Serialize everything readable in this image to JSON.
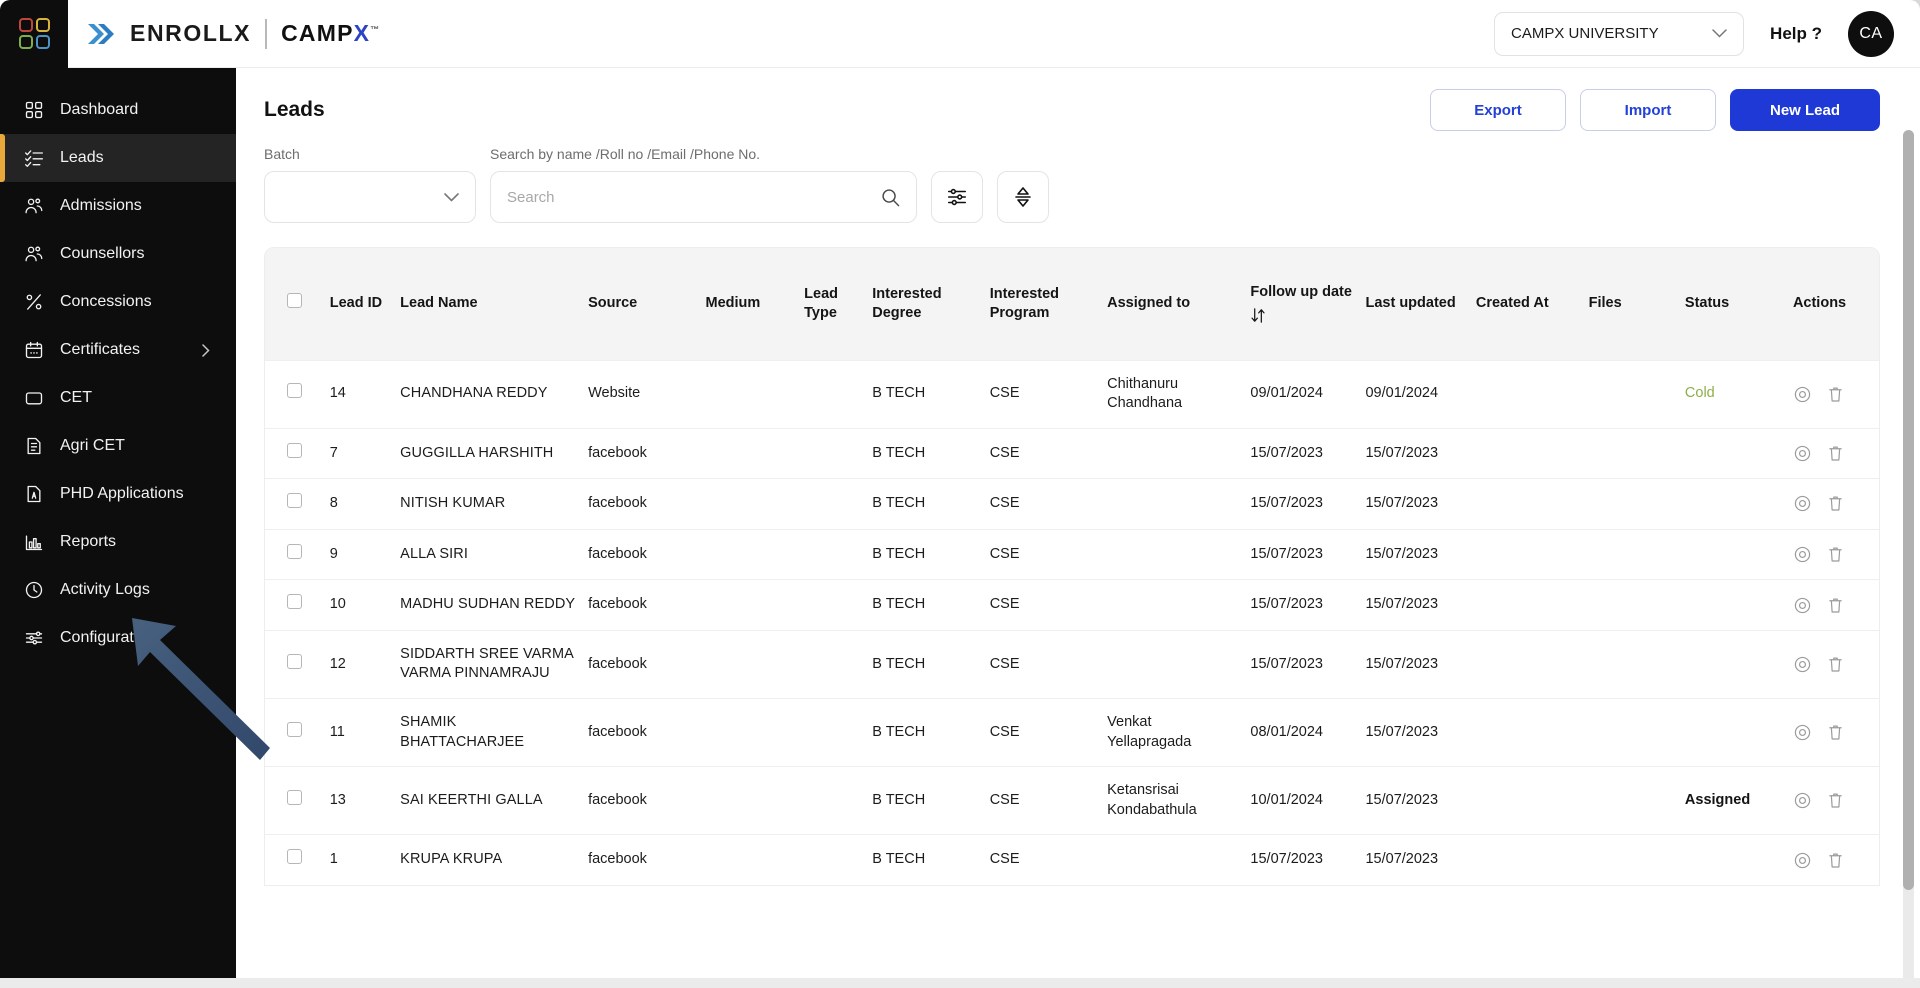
{
  "app": {
    "logo_icon": "grid-logo-icon",
    "brand_primary": "ENROLLX",
    "brand_secondary": "CAMPX",
    "brand_secondary_accent": "X",
    "brand_tm": "™"
  },
  "header": {
    "org_value": "CAMPX UNIVERSITY",
    "org_caret_icon": "chevron-down-icon",
    "help_label": "Help ?",
    "avatar_initials": "CA"
  },
  "sidebar": {
    "items": [
      {
        "label": "Dashboard",
        "icon": "dashboard-grid-icon",
        "active": false,
        "has_caret": false
      },
      {
        "label": "Leads",
        "icon": "checklist-icon",
        "active": true,
        "has_caret": false
      },
      {
        "label": "Admissions",
        "icon": "users-icon",
        "active": false,
        "has_caret": false
      },
      {
        "label": "Counsellors",
        "icon": "users-icon",
        "active": false,
        "has_caret": false
      },
      {
        "label": "Concessions",
        "icon": "percent-icon",
        "active": false,
        "has_caret": false
      },
      {
        "label": "Certificates",
        "icon": "calendar-icon",
        "active": false,
        "has_caret": true
      },
      {
        "label": "CET",
        "icon": "square-icon",
        "active": false,
        "has_caret": false
      },
      {
        "label": "Agri CET",
        "icon": "document-lines-icon",
        "active": false,
        "has_caret": false
      },
      {
        "label": "PHD Applications",
        "icon": "document-a-icon",
        "active": false,
        "has_caret": false
      },
      {
        "label": "Reports",
        "icon": "bar-chart-icon",
        "active": false,
        "has_caret": false
      },
      {
        "label": "Activity Logs",
        "icon": "clock-icon",
        "active": false,
        "has_caret": false
      },
      {
        "label": "Configuration",
        "icon": "sliders-icon",
        "active": false,
        "has_caret": false
      }
    ],
    "active_accent": "#e8a93a"
  },
  "page": {
    "title": "Leads",
    "buttons": {
      "export": "Export",
      "import": "Import",
      "new_lead": "New Lead"
    },
    "primary_color": "#1f39d6"
  },
  "filters": {
    "batch_label": "Batch",
    "batch_value": "",
    "batch_caret_icon": "chevron-down-icon",
    "search_label": "Search by name /Roll no /Email /Phone No.",
    "search_value": "",
    "search_placeholder": "Search",
    "search_icon": "search-icon",
    "filter_button_icon": "sliders-icon",
    "sort_button_icon": "sort-updown-icon"
  },
  "table": {
    "select_all_icon": "checkbox-icon",
    "columns": [
      "Lead ID",
      "Lead Name",
      "Source",
      "Medium",
      "Lead Type",
      "Interested Degree",
      "Interested Program",
      "Assigned to",
      "Follow up date",
      "Last updated",
      "Created At",
      "Files",
      "Status",
      "Actions"
    ],
    "followup_sort_icon": "sort-arrows-icon",
    "row_icons": {
      "view": "view-eye-icon",
      "delete": "trash-icon"
    },
    "status_colors": {
      "Cold": "#8fae4a",
      "Assigned": "#141414"
    },
    "rows": [
      {
        "lead_id": "14",
        "lead_name": "CHANDHANA REDDY",
        "source": "Website",
        "medium": "",
        "lead_type": "",
        "interested_degree": "B TECH",
        "interested_program": "CSE",
        "assigned_to": "Chithanuru Chandhana",
        "follow_up_date": "09/01/2024",
        "last_updated": "09/01/2024",
        "created_at": "",
        "files": "",
        "status": "Cold"
      },
      {
        "lead_id": "7",
        "lead_name": "GUGGILLA HARSHITH",
        "source": "facebook",
        "medium": "",
        "lead_type": "",
        "interested_degree": "B TECH",
        "interested_program": "CSE",
        "assigned_to": "",
        "follow_up_date": "15/07/2023",
        "last_updated": "15/07/2023",
        "created_at": "",
        "files": "",
        "status": ""
      },
      {
        "lead_id": "8",
        "lead_name": "NITISH KUMAR",
        "source": "facebook",
        "medium": "",
        "lead_type": "",
        "interested_degree": "B TECH",
        "interested_program": "CSE",
        "assigned_to": "",
        "follow_up_date": "15/07/2023",
        "last_updated": "15/07/2023",
        "created_at": "",
        "files": "",
        "status": ""
      },
      {
        "lead_id": "9",
        "lead_name": "ALLA SIRI",
        "source": "facebook",
        "medium": "",
        "lead_type": "",
        "interested_degree": "B TECH",
        "interested_program": "CSE",
        "assigned_to": "",
        "follow_up_date": "15/07/2023",
        "last_updated": "15/07/2023",
        "created_at": "",
        "files": "",
        "status": ""
      },
      {
        "lead_id": "10",
        "lead_name": "MADHU SUDHAN REDDY",
        "source": "facebook",
        "medium": "",
        "lead_type": "",
        "interested_degree": "B TECH",
        "interested_program": "CSE",
        "assigned_to": "",
        "follow_up_date": "15/07/2023",
        "last_updated": "15/07/2023",
        "created_at": "",
        "files": "",
        "status": ""
      },
      {
        "lead_id": "12",
        "lead_name": "SIDDARTH SREE VARMA VARMA PINNAMRAJU",
        "source": "facebook",
        "medium": "",
        "lead_type": "",
        "interested_degree": "B TECH",
        "interested_program": "CSE",
        "assigned_to": "",
        "follow_up_date": "15/07/2023",
        "last_updated": "15/07/2023",
        "created_at": "",
        "files": "",
        "status": ""
      },
      {
        "lead_id": "11",
        "lead_name": "SHAMIK BHATTACHARJEE",
        "source": "facebook",
        "medium": "",
        "lead_type": "",
        "interested_degree": "B TECH",
        "interested_program": "CSE",
        "assigned_to": "Venkat Yellapragada",
        "follow_up_date": "08/01/2024",
        "last_updated": "15/07/2023",
        "created_at": "",
        "files": "",
        "status": ""
      },
      {
        "lead_id": "13",
        "lead_name": "SAI KEERTHI GALLA",
        "source": "facebook",
        "medium": "",
        "lead_type": "",
        "interested_degree": "B TECH",
        "interested_program": "CSE",
        "assigned_to": "Ketansrisai Kondabathula",
        "follow_up_date": "10/01/2024",
        "last_updated": "15/07/2023",
        "created_at": "",
        "files": "",
        "status": "Assigned"
      },
      {
        "lead_id": "1",
        "lead_name": "KRUPA KRUPA",
        "source": "facebook",
        "medium": "",
        "lead_type": "",
        "interested_degree": "B TECH",
        "interested_program": "CSE",
        "assigned_to": "",
        "follow_up_date": "15/07/2023",
        "last_updated": "15/07/2023",
        "created_at": "",
        "files": "",
        "status": ""
      }
    ]
  },
  "annotation": {
    "arrow_icon": "pointer-arrow-icon",
    "arrow_color": "#3f5b80",
    "points_to": "Configuration"
  }
}
